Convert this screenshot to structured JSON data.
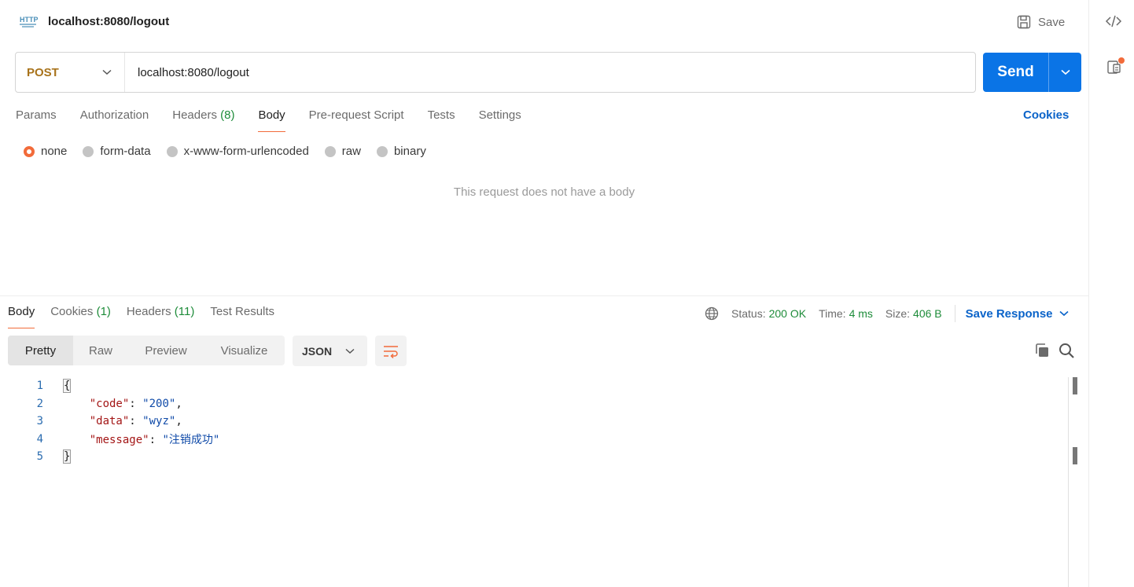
{
  "header": {
    "title": "localhost:8080/logout",
    "save_label": "Save"
  },
  "request": {
    "method": "POST",
    "url": "localhost:8080/logout",
    "send_label": "Send"
  },
  "request_tabs": {
    "params": "Params",
    "authorization": "Authorization",
    "headers": "Headers",
    "headers_count": "(8)",
    "body": "Body",
    "prerequest": "Pre-request Script",
    "tests": "Tests",
    "settings": "Settings",
    "cookies": "Cookies"
  },
  "body_types": {
    "none": "none",
    "form_data": "form-data",
    "urlencoded": "x-www-form-urlencoded",
    "raw": "raw",
    "binary": "binary"
  },
  "empty_body_message": "This request does not have a body",
  "response_tabs": {
    "body": "Body",
    "cookies": "Cookies",
    "cookies_count": "(1)",
    "headers": "Headers",
    "headers_count": "(11)",
    "test_results": "Test Results"
  },
  "response_meta": {
    "status_label": "Status:",
    "status_value": "200 OK",
    "time_label": "Time:",
    "time_value": "4 ms",
    "size_label": "Size:",
    "size_value": "406 B",
    "save_response": "Save Response"
  },
  "view_modes": {
    "pretty": "Pretty",
    "raw": "Raw",
    "preview": "Preview",
    "visualize": "Visualize"
  },
  "format": "JSON",
  "code_lines": {
    "n1": "1",
    "n2": "2",
    "n3": "3",
    "n4": "4",
    "n5": "5",
    "open_brace": "{",
    "close_brace": "}",
    "code_key": "\"code\"",
    "code_val": "\"200\"",
    "data_key": "\"data\"",
    "data_val": "\"wyz\"",
    "message_key": "\"message\"",
    "message_val": "\"注销成功\""
  },
  "colors": {
    "accent": "#f26b3a",
    "send": "#0a74e6",
    "method": "#a8731b",
    "success": "#1e8c3a",
    "link": "#0a63c9"
  }
}
